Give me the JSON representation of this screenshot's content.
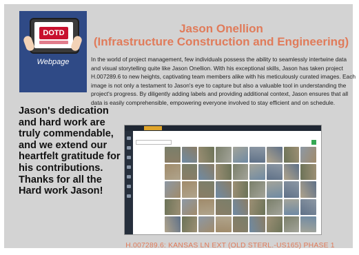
{
  "logo": {
    "brand": "DOTD",
    "caption": "Webpage",
    "tile_color": "#2f4a86"
  },
  "header": {
    "title_line1": "Jason Onellion",
    "title_line2": "(Infrastructure Construction and Engineering)",
    "title_color": "#e07b5a"
  },
  "intro_text": "In the world of project management, few individuals possess the ability to seamlessly intertwine data and visual storytelling quite like Jason Onellion. With his exceptional skills, Jason has taken project H.007289.6 to new heights, captivating team members alike with his meticulously curated images. Each image is not only a testament to Jason's eye to capture but also a valuable tool in understanding the project's progress. By diligently adding labels and providing additional context, Jason ensures that all data is easily comprehensible, empowering everyone involved to stay efficient and on schedule.",
  "thanks_text": "Jason's dedication and hard work are truly commendable, and we extend our heartfelt gratitude for his contributions. Thanks for all the Hard work Jason!",
  "screenshot": {
    "brand": "",
    "tab": "",
    "header": "",
    "search_placeholder": "",
    "thumbnail_count": 45
  },
  "footer": {
    "caption": "H.007289.6: KANSAS LN EXT (OLD STERL.-US165) PHASE 1",
    "color": "#e07b5a"
  }
}
